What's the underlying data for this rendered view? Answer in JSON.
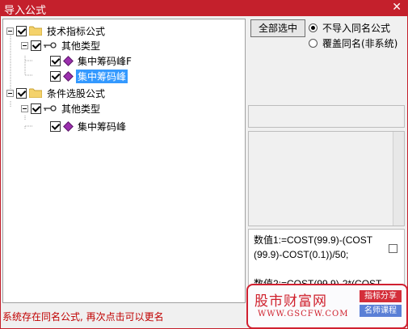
{
  "window": {
    "title": "导入公式",
    "close_glyph": "✕"
  },
  "tree": {
    "groups": [
      {
        "label": "技术指标公式",
        "checked": true,
        "children": [
          {
            "label": "其他类型",
            "checked": true,
            "items": [
              {
                "label": "集中筹码峰F",
                "checked": true,
                "selected": false
              },
              {
                "label": "集中筹码峰",
                "checked": true,
                "selected": true
              }
            ]
          }
        ]
      },
      {
        "label": "条件选股公式",
        "checked": true,
        "children": [
          {
            "label": "其他类型",
            "checked": true,
            "items": [
              {
                "label": "集中筹码峰",
                "checked": true,
                "selected": false
              }
            ]
          }
        ]
      }
    ]
  },
  "options": {
    "select_all_label": "全部选中",
    "radio_no_import": "不导入同名公式",
    "radio_overwrite": "覆盖同名(非系统)",
    "selected_radio": "no_import"
  },
  "formula": {
    "text": "数值1:=COST(99.9)-(COST\n(99.9)-COST(0.1))/50;\n\n数值2:=COST(99.9)-2*(COST"
  },
  "status": {
    "message": "系统存在同名公式, 再次点击可以更名"
  },
  "watermark": {
    "title": "股市财富网",
    "url": "WWW.GSCFW.COM",
    "tag1": "指标分享",
    "tag2": "名师课程"
  },
  "colors": {
    "titlebar": "#c4202c",
    "selection": "#3399ff",
    "status_text": "#c00000"
  }
}
